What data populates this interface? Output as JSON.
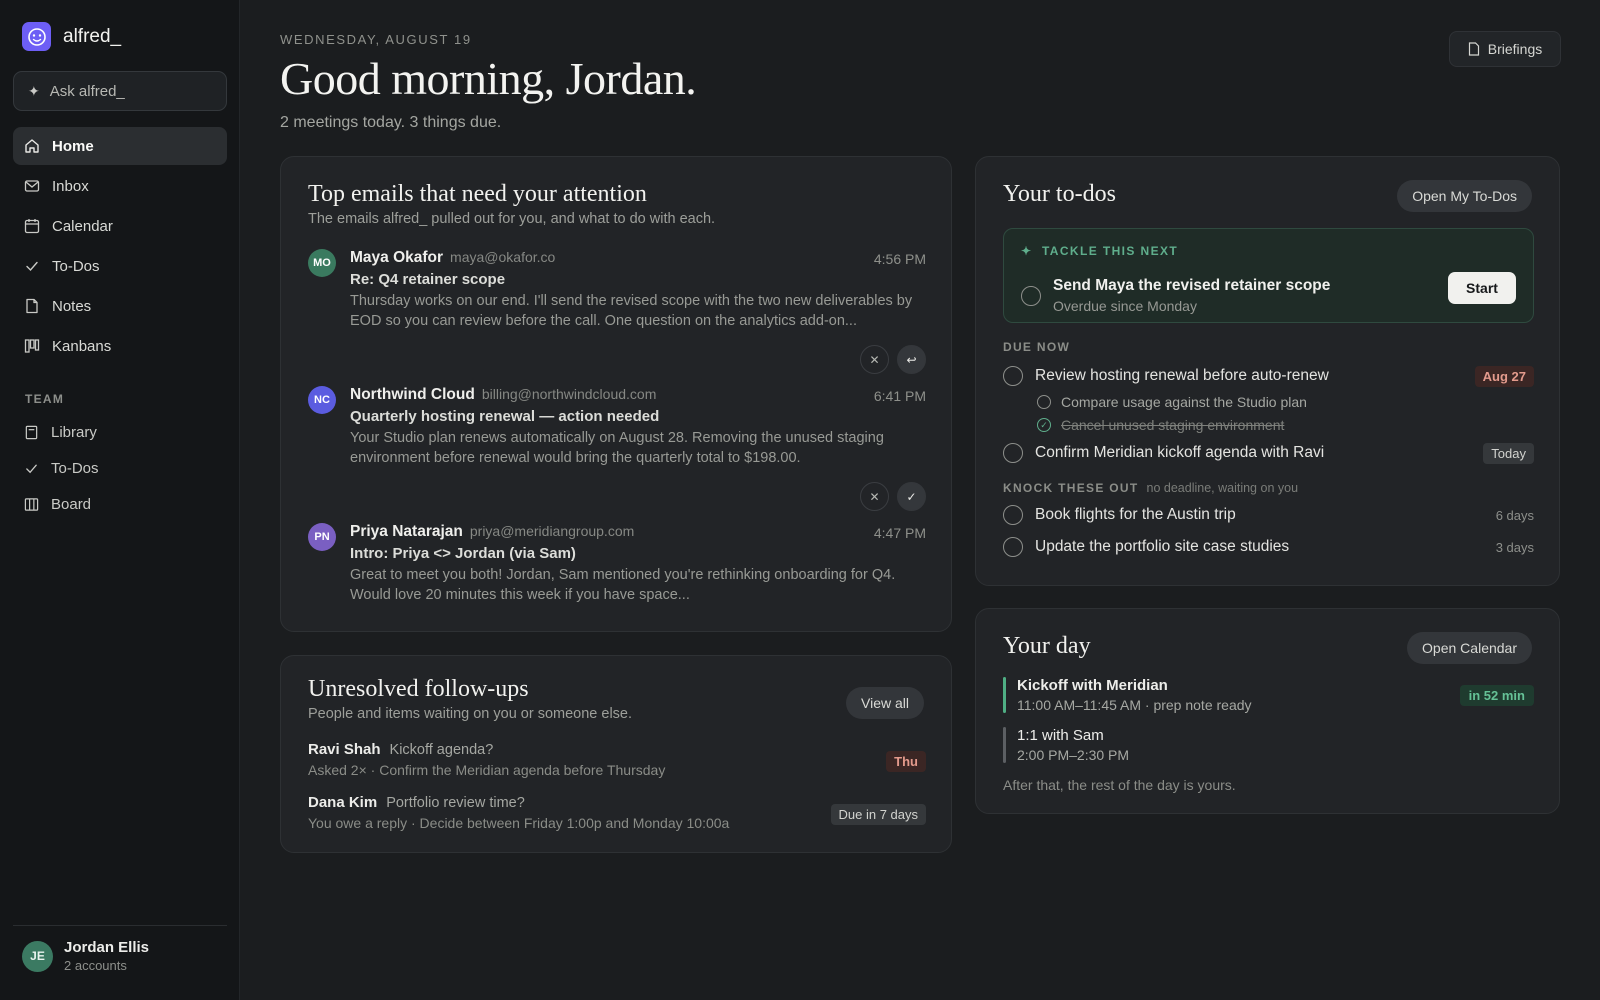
{
  "app": {
    "name": "alfred_",
    "ask_placeholder": "Ask alfred_"
  },
  "sidebar": {
    "nav": [
      {
        "label": "Home",
        "icon": "home-icon",
        "active": true
      },
      {
        "label": "Inbox",
        "icon": "mail-icon"
      },
      {
        "label": "Calendar",
        "icon": "calendar-icon"
      },
      {
        "label": "To-Dos",
        "icon": "check-icon"
      },
      {
        "label": "Notes",
        "icon": "note-icon"
      },
      {
        "label": "Kanbans",
        "icon": "kanban-icon"
      }
    ],
    "team_label": "TEAM",
    "team": [
      {
        "label": "Library",
        "icon": "book-icon"
      },
      {
        "label": "To-Dos",
        "icon": "check-icon"
      },
      {
        "label": "Board",
        "icon": "board-icon"
      }
    ],
    "user": {
      "initials": "JE",
      "name": "Jordan Ellis",
      "sub": "2 accounts"
    }
  },
  "header": {
    "date": "WEDNESDAY, AUGUST 19",
    "greeting": "Good morning, Jordan.",
    "summary": "2 meetings today. 3 things due.",
    "briefings_label": "Briefings"
  },
  "emails": {
    "title": "Top emails that need your attention",
    "subtitle": "The emails alfred_ pulled out for you, and what to do with each.",
    "items": [
      {
        "initials": "MO",
        "avatar_color": "#3a7a5f",
        "from": "Maya Okafor",
        "address": "maya@okafor.co",
        "time": "4:56 PM",
        "subject": "Re: Q4 retainer scope",
        "snippet": "Thursday works on our end. I'll send the revised scope with the two new deliverables by EOD so you can review before the call. One question on the analytics add-on..."
      },
      {
        "initials": "NC",
        "avatar_color": "#5b5ce0",
        "from": "Northwind Cloud",
        "address": "billing@northwindcloud.com",
        "time": "6:41 PM",
        "subject": "Quarterly hosting renewal — action needed",
        "snippet": "Your Studio plan renews automatically on August 28. Removing the unused staging environment before renewal would bring the quarterly total to $198.00."
      },
      {
        "initials": "PN",
        "avatar_color": "#7a5fc2",
        "from": "Priya Natarajan",
        "address": "priya@meridiangroup.com",
        "time": "4:47 PM",
        "subject": "Intro: Priya <> Jordan (via Sam)",
        "snippet": "Great to meet you both! Jordan, Sam mentioned you're rethinking onboarding for Q4. Would love 20 minutes this week if you have space..."
      }
    ]
  },
  "followups": {
    "title": "Unresolved follow-ups",
    "subtitle": "People and items waiting on you or someone else.",
    "view_all": "View all",
    "items": [
      {
        "name": "Ravi Shah",
        "topic": "Kickoff agenda?",
        "sub": "Asked 2× · Confirm the Meridian agenda before Thursday",
        "tag": "Thu"
      },
      {
        "name": "Dana Kim",
        "topic": "Portfolio review time?",
        "sub": "You owe a reply · Decide between Friday 1:00p and Monday 10:00a",
        "tag": "Due in 7 days"
      }
    ]
  },
  "todos": {
    "title": "Your to-dos",
    "open_label": "Open My To-Dos",
    "tackle": {
      "label": "TACKLE THIS NEXT",
      "title": "Send Maya the revised retainer scope",
      "sub": "Overdue since Monday",
      "start": "Start"
    },
    "due_now_label": "DUE NOW",
    "due_now": [
      {
        "text": "Review hosting renewal before auto-renew",
        "tag": "Aug 27"
      },
      {
        "text": "Confirm Meridian kickoff agenda with Ravi",
        "tag": "Today"
      }
    ],
    "subtasks": [
      {
        "text": "Compare usage against the Studio plan",
        "done": false
      },
      {
        "text": "Cancel unused staging environment",
        "done": true
      }
    ],
    "knock_label": "KNOCK THESE OUT",
    "knock_note": "no deadline, waiting on you",
    "knock": [
      {
        "text": "Book flights for the Austin trip",
        "tag": "6 days"
      },
      {
        "text": "Update the portfolio site case studies",
        "tag": "3 days"
      }
    ]
  },
  "day": {
    "title": "Your day",
    "open_label": "Open Calendar",
    "events": [
      {
        "title": "Kickoff with Meridian",
        "time": "11:00 AM–11:45 AM · prep note ready",
        "badge": "in 52 min",
        "bar_color": "#4fae84"
      },
      {
        "title": "1:1 with Sam",
        "time": "2:00 PM–2:30 PM",
        "bar_color": "#5c5f63"
      }
    ],
    "footer": "After that, the rest of the day is yours."
  },
  "colors": {
    "accent": "#6d5ef5",
    "green": "#5fae8c",
    "red": "#e39a8c"
  }
}
